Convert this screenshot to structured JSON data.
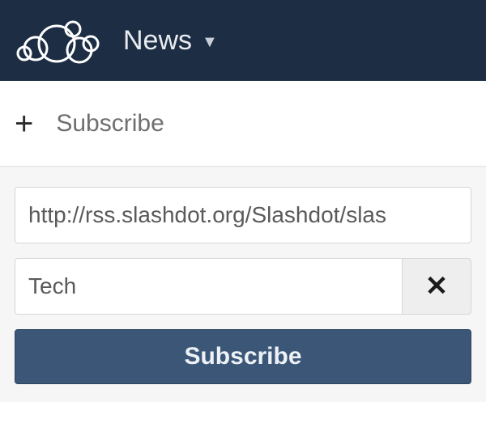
{
  "topbar": {
    "app_label": "News"
  },
  "subscribe_row": {
    "label": "Subscribe"
  },
  "form": {
    "url_value": "http://rss.slashdot.org/Slashdot/slas",
    "group_value": "Tech",
    "submit_label": "Subscribe"
  },
  "colors": {
    "topbar_bg": "#1d2d44",
    "panel_bg": "#f6f6f6",
    "button_bg": "#3b5677"
  }
}
